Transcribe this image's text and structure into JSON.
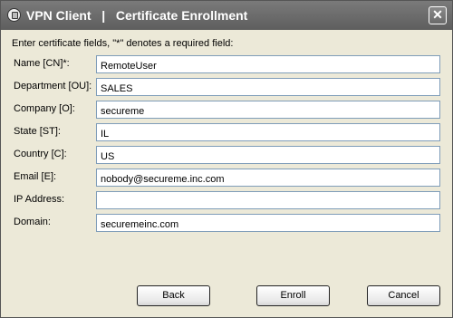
{
  "window": {
    "title_app": "VPN Client",
    "title_separator": "|",
    "title_page": "Certificate Enrollment",
    "close_glyph": "✕"
  },
  "instructions": "Enter certificate fields, \"*\" denotes a required field:",
  "fields": [
    {
      "label": "Name [CN]*:",
      "value": "RemoteUser"
    },
    {
      "label": "Department [OU]:",
      "value": "SALES"
    },
    {
      "label": "Company [O]:",
      "value": "secureme"
    },
    {
      "label": "State [ST]:",
      "value": "IL"
    },
    {
      "label": "Country [C]:",
      "value": "US"
    },
    {
      "label": "Email [E]:",
      "value": "nobody@secureme.inc.com"
    },
    {
      "label": "IP Address:",
      "value": ""
    },
    {
      "label": "Domain:",
      "value": "securemeinc.com"
    }
  ],
  "buttons": {
    "back": "Back",
    "enroll": "Enroll",
    "cancel": "Cancel"
  },
  "icons": {
    "app": "vpn-client-icon",
    "close": "close-icon"
  }
}
